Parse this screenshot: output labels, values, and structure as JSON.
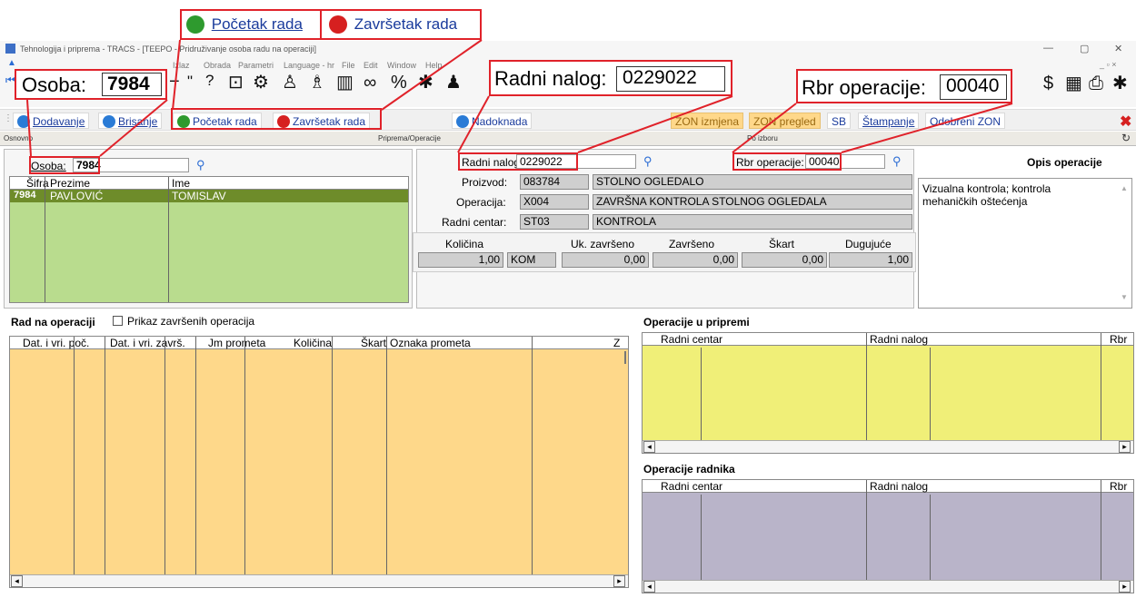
{
  "callouts": {
    "start_label": "Početak rada",
    "end_label": "Završetak rada",
    "osoba_label": "Osoba:",
    "osoba_value": "7984",
    "radni_nalog_label": "Radni nalog:",
    "radni_nalog_value": "0229022",
    "rbr_label": "Rbr operacije:",
    "rbr_value": "00040"
  },
  "window": {
    "title": "Tehnologija i priprema - TRACS - [TEEPO - Pridruživanje osoba radu na operaciji]",
    "menu": [
      "Izlaz",
      "Obrada",
      "Parametri",
      "Language - hr",
      "File",
      "Edit",
      "Window",
      "Help"
    ],
    "controls": [
      "—",
      "▢",
      "✕"
    ]
  },
  "toolbar": {
    "add": "Dodavanje",
    "delete": "Brisanje",
    "start": "Početak rada",
    "end": "Završetak rada",
    "compensation": "Nadoknada",
    "zon_change": "ZON izmjena",
    "zon_view": "ZON pregled",
    "sb": "SB",
    "print": "Štampanje",
    "approved_zon": "Odobreni ZON"
  },
  "tabs": {
    "basic": "Osnovno",
    "prep": "Priprema/Operacije",
    "choice": "Po izboru"
  },
  "person": {
    "label": "Osoba:",
    "value": "7984",
    "columns": [
      "Šifra",
      "Prezime",
      "Ime"
    ],
    "rows": [
      [
        "7984",
        "PAVLOVIĆ",
        "TOMISLAV"
      ]
    ]
  },
  "order": {
    "radni_nalog_label": "Radni nalog:",
    "radni_nalog_value": "0229022",
    "rbr_label": "Rbr operacije:",
    "rbr_value": "00040",
    "proizvod_label": "Proizvod:",
    "proizvod_code": "083784",
    "proizvod_name": "STOLNO OGLEDALO",
    "operacija_label": "Operacija:",
    "operacija_code": "X004",
    "operacija_name": "ZAVRŠNA KONTROLA STOLNOG OGLEDALA",
    "centar_label": "Radni centar:",
    "centar_code": "ST03",
    "centar_name": "KONTROLA"
  },
  "quantities": {
    "kolicina_label": "Količina",
    "uk_zavrseno_label": "Uk. završeno",
    "zavrseno_label": "Završeno",
    "skart_label": "Škart",
    "dugujuce_label": "Dugujuće",
    "kolicina": "1,00",
    "unit": "KOM",
    "uk_zavrseno": "0,00",
    "zavrseno": "0,00",
    "skart": "0,00",
    "dugujuce": "1,00"
  },
  "description": {
    "title": "Opis operacije",
    "text": "Vizualna kontrola; kontrola mehaničkih oštećenja"
  },
  "work": {
    "title": "Rad na operaciji",
    "checkbox_label": "Prikaz završenih operacija",
    "columns": [
      "Dat. i vri. poč.",
      "Dat. i vri. završ.",
      "Jm prometa",
      "Količina",
      "Škart",
      "Oznaka prometa",
      "Z"
    ]
  },
  "prep_ops": {
    "title": "Operacije u pripremi",
    "columns": [
      "Radni centar",
      "Radni nalog",
      "Rbr"
    ]
  },
  "worker_ops": {
    "title": "Operacije radnika",
    "columns": [
      "Radni centar",
      "Radni nalog",
      "Rbr"
    ]
  },
  "colors": {
    "callout": "#e0222a",
    "person_grid": "#b9dc8e",
    "work_grid": "#fed88a",
    "prep_grid": "#f0ef78",
    "worker_grid": "#b9b4c9",
    "selected_row": "#6e8c2a"
  }
}
